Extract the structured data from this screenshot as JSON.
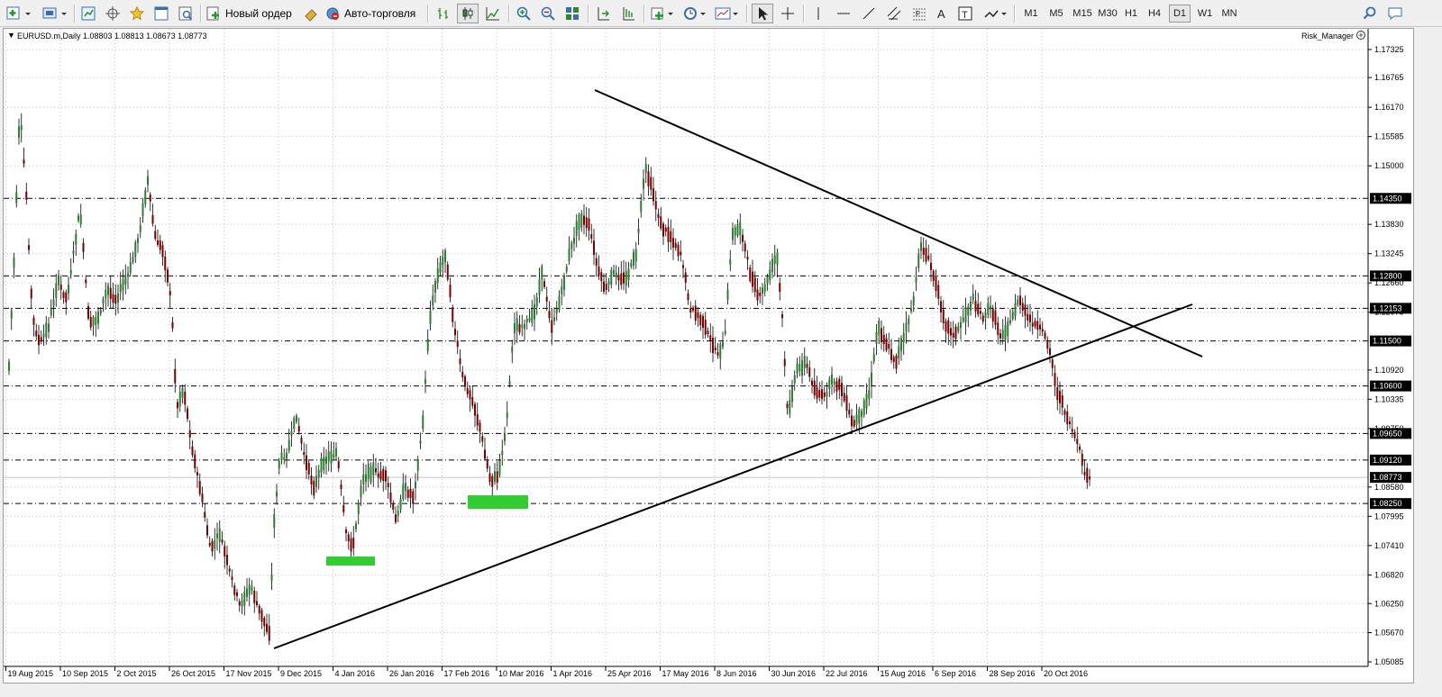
{
  "toolbar": {
    "new_order_label": "Новый ордер",
    "auto_trading_label": "Авто-торговля",
    "timeframes": [
      "M1",
      "M5",
      "M15",
      "M30",
      "H1",
      "H4",
      "D1",
      "W1",
      "MN"
    ],
    "active_timeframe": "D1"
  },
  "chart": {
    "header": "EURUSD.m,Daily  1.08803 1.08813 1.08673 1.08773",
    "indicator_label": "Risk_Manager",
    "up_color": "#2e7d32",
    "down_color": "#7a0000",
    "highlight_color": "#33cc33",
    "price_levels": [
      "1.17325",
      "1.16765",
      "1.16170",
      "1.15585",
      "1.15000",
      "1.13830",
      "1.13245",
      "1.12660",
      "1.12075",
      "1.10920",
      "1.10335",
      "1.09750",
      "1.08580",
      "1.07995",
      "1.07410",
      "1.06820",
      "1.06250",
      "1.05670",
      "1.05085"
    ],
    "horizontal_lines": [
      "1.14350",
      "1.12800",
      "1.12153",
      "1.11500",
      "1.10600",
      "1.09650",
      "1.09120",
      "1.08250"
    ],
    "current_price": "1.08773",
    "date_labels": [
      "19 Aug 2015",
      "10 Sep 2015",
      "2 Oct 2015",
      "26 Oct 2015",
      "17 Nov 2015",
      "9 Dec 2015",
      "4 Jan 2016",
      "26 Jan 2016",
      "17 Feb 2016",
      "10 Mar 2016",
      "1 Apr 2016",
      "25 Apr 2016",
      "17 May 2016",
      "8 Jun 2016",
      "30 Jun 2016",
      "22 Jul 2016",
      "15 Aug 2016",
      "6 Sep 2016",
      "28 Sep 2016",
      "20 Oct 2016"
    ]
  }
}
